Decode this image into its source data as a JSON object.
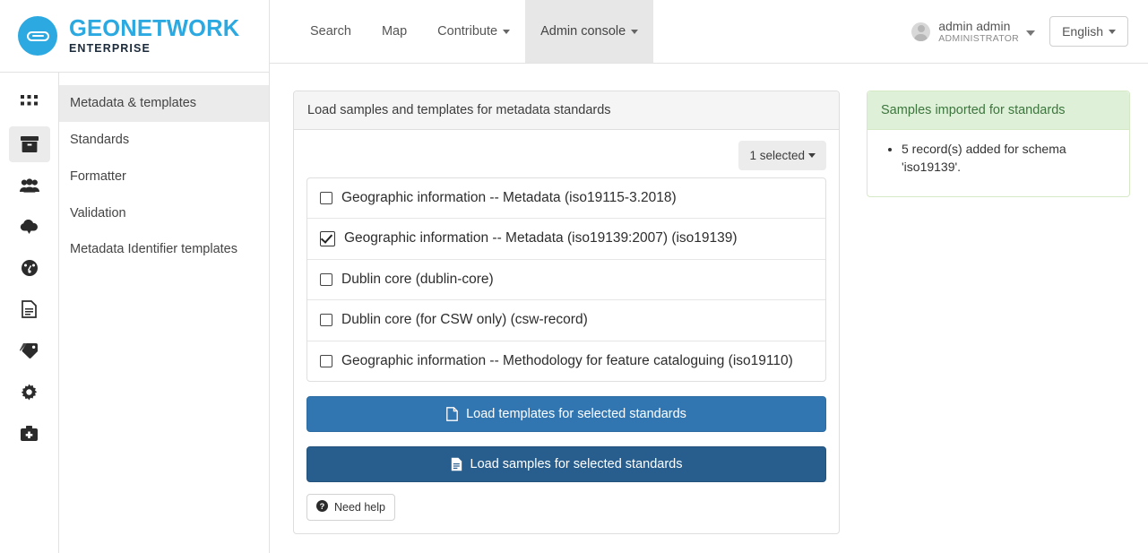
{
  "brand": {
    "title": "GEONETWORK",
    "subtitle": "ENTERPRISE",
    "logo_icon": "geonetwork-link-logo-icon",
    "accent_color": "#2ba9e0"
  },
  "topnav": {
    "items": [
      {
        "label": "Search",
        "has_caret": false,
        "active": false
      },
      {
        "label": "Map",
        "has_caret": false,
        "active": false
      },
      {
        "label": "Contribute",
        "has_caret": true,
        "active": false
      },
      {
        "label": "Admin console",
        "has_caret": true,
        "active": true
      }
    ],
    "user": {
      "name": "admin admin",
      "role": "ADMINISTRATOR",
      "avatar_icon": "user-avatar-icon",
      "caret_icon": "chevron-down-icon"
    },
    "language": {
      "label": "English",
      "caret_icon": "chevron-down-icon"
    }
  },
  "rail": {
    "items": [
      {
        "icon": "apps-grid-icon",
        "active": false
      },
      {
        "icon": "archive-box-icon",
        "active": true
      },
      {
        "icon": "users-group-icon",
        "active": false
      },
      {
        "icon": "cloud-download-icon",
        "active": false
      },
      {
        "icon": "dashboard-gauge-icon",
        "active": false
      },
      {
        "icon": "file-document-icon",
        "active": false
      },
      {
        "icon": "tags-icon",
        "active": false
      },
      {
        "icon": "gear-icon",
        "active": false
      },
      {
        "icon": "medkit-icon",
        "active": false
      }
    ]
  },
  "submenu": {
    "items": [
      {
        "label": "Metadata & templates",
        "active": true
      },
      {
        "label": "Standards",
        "active": false
      },
      {
        "label": "Formatter",
        "active": false
      },
      {
        "label": "Validation",
        "active": false
      },
      {
        "label": "Metadata Identifier templates",
        "active": false
      }
    ]
  },
  "panel": {
    "title": "Load samples and templates for metadata standards",
    "selected_dropdown": {
      "label": "1 selected",
      "caret_icon": "caret-down-icon"
    },
    "standards": [
      {
        "label": "Geographic information -- Metadata (iso19115-3.2018)",
        "checked": false
      },
      {
        "label": "Geographic information -- Metadata (iso19139:2007) (iso19139)",
        "checked": true
      },
      {
        "label": "Dublin core (dublin-core)",
        "checked": false
      },
      {
        "label": "Dublin core (for CSW only) (csw-record)",
        "checked": false
      },
      {
        "label": "Geographic information -- Methodology for feature cataloguing (iso19110)",
        "checked": false
      }
    ],
    "buttons": {
      "load_templates": {
        "label": "Load templates for selected standards",
        "icon": "file-outline-icon",
        "color": "#3276b1"
      },
      "load_samples": {
        "label": "Load samples for selected standards",
        "icon": "file-text-icon",
        "color": "#285e8e"
      }
    },
    "help": {
      "label": "Need help",
      "icon": "question-circle-icon"
    }
  },
  "success": {
    "title": "Samples imported for standards",
    "header_bg": "#dff0d8",
    "header_color": "#3c763d",
    "messages": [
      "5 record(s) added for schema 'iso19139'."
    ]
  }
}
